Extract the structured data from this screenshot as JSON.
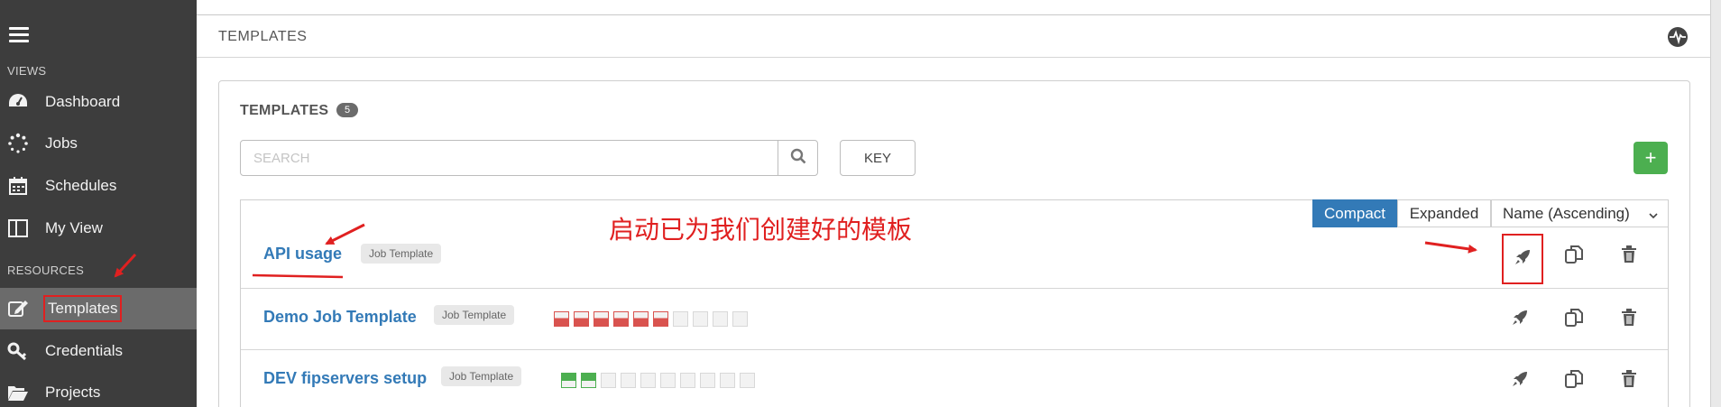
{
  "sidebar": {
    "views_label": "VIEWS",
    "resources_label": "RESOURCES",
    "items": [
      {
        "label": "Dashboard",
        "icon": "dashboard-icon"
      },
      {
        "label": "Jobs",
        "icon": "spinner-icon"
      },
      {
        "label": "Schedules",
        "icon": "calendar-icon"
      },
      {
        "label": "My View",
        "icon": "columns-icon"
      },
      {
        "label": "Templates",
        "icon": "edit-icon",
        "active": true
      },
      {
        "label": "Credentials",
        "icon": "key-icon"
      },
      {
        "label": "Projects",
        "icon": "folder-open-icon"
      }
    ]
  },
  "header": {
    "title": "TEMPLATES",
    "icon": "activity-stream-icon"
  },
  "panel": {
    "title": "TEMPLATES",
    "count": "5",
    "search_placeholder": "SEARCH",
    "key_label": "KEY",
    "add_label": "+"
  },
  "view_options": {
    "compact": "Compact",
    "expanded": "Expanded",
    "sort": "Name (Ascending)",
    "active": "Compact"
  },
  "templates": [
    {
      "name": "API usage",
      "type": "Job Template",
      "jobs": []
    },
    {
      "name": "Demo Job Template",
      "type": "Job Template",
      "jobs": [
        "fail",
        "fail",
        "fail",
        "fail",
        "fail",
        "fail",
        "none",
        "none",
        "none",
        "none"
      ]
    },
    {
      "name": "DEV fipservers setup",
      "type": "Job Template",
      "jobs": [
        "ok",
        "ok",
        "none",
        "none",
        "none",
        "none",
        "none",
        "none",
        "none",
        "none"
      ]
    }
  ],
  "annotation": "启动已为我们创建好的模板",
  "colors": {
    "sidebar": "#3d3d3d",
    "accent": "#337ab7",
    "add": "#4caf50",
    "fail": "#d9534f",
    "success": "#4caf50",
    "annotation": "#e02020"
  }
}
